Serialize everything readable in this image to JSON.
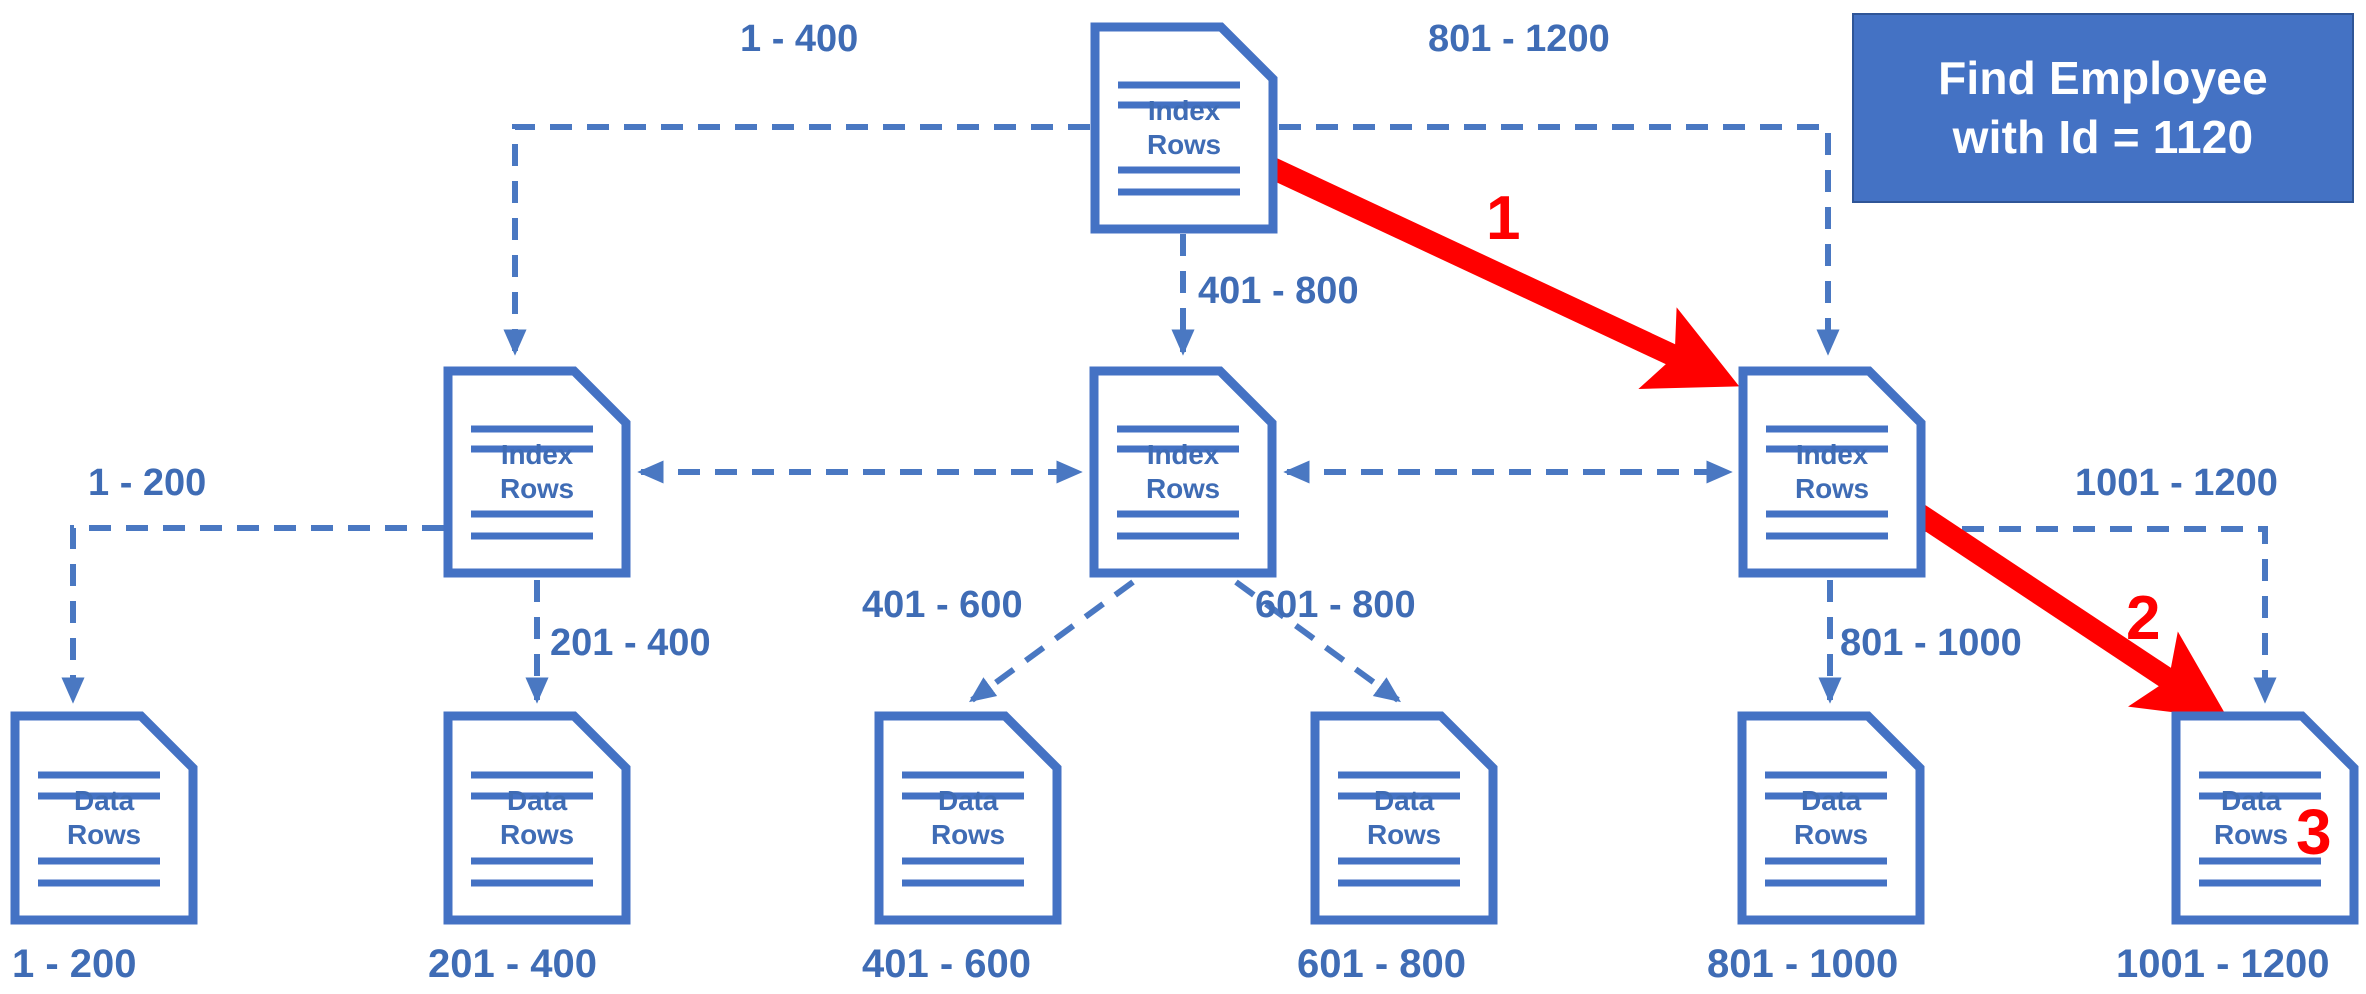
{
  "title_box": {
    "line1": "Find Employee",
    "line2": "with Id = 1120",
    "bg_color": "#4472c4",
    "border_color": "#2f5597",
    "text_color": "#ffffff"
  },
  "theme": {
    "node_color": "#3f6cb5",
    "edge_color": "#4a78c2",
    "highlight_color": "#ff0000",
    "background": "#ffffff"
  },
  "nodes": {
    "root": {
      "line1": "Index",
      "line2": "Rows",
      "type": "index"
    },
    "index_left": {
      "line1": "Index",
      "line2": "Rows",
      "type": "index"
    },
    "index_center": {
      "line1": "Index",
      "line2": "Rows",
      "type": "index"
    },
    "index_right": {
      "line1": "Index",
      "line2": "Rows",
      "type": "index"
    },
    "leaf1": {
      "line1": "Data",
      "line2": "Rows",
      "type": "data"
    },
    "leaf2": {
      "line1": "Data",
      "line2": "Rows",
      "type": "data"
    },
    "leaf3": {
      "line1": "Data",
      "line2": "Rows",
      "type": "data"
    },
    "leaf4": {
      "line1": "Data",
      "line2": "Rows",
      "type": "data"
    },
    "leaf5": {
      "line1": "Data",
      "line2": "Rows",
      "type": "data"
    },
    "leaf6": {
      "line1": "Data",
      "line2": "Rows",
      "type": "data"
    }
  },
  "edge_labels": {
    "root_to_left": "1 - 400",
    "root_to_center": "401 - 800",
    "root_to_right": "801 - 1200",
    "left_to_leaf1": "1 - 200",
    "left_to_leaf2": "201 - 400",
    "center_to_leaf3": "401 - 600",
    "center_to_leaf4": "601 - 800",
    "right_to_leaf5": "801 - 1000",
    "right_to_leaf6": "1001 - 1200"
  },
  "leaf_labels": {
    "leaf1": "1 - 200",
    "leaf2": "201 - 400",
    "leaf3": "401 - 600",
    "leaf4": "601 - 800",
    "leaf5": "801 - 1000",
    "leaf6": "1001 - 1200"
  },
  "steps": {
    "step1": "1",
    "step2": "2",
    "step3": "3"
  }
}
